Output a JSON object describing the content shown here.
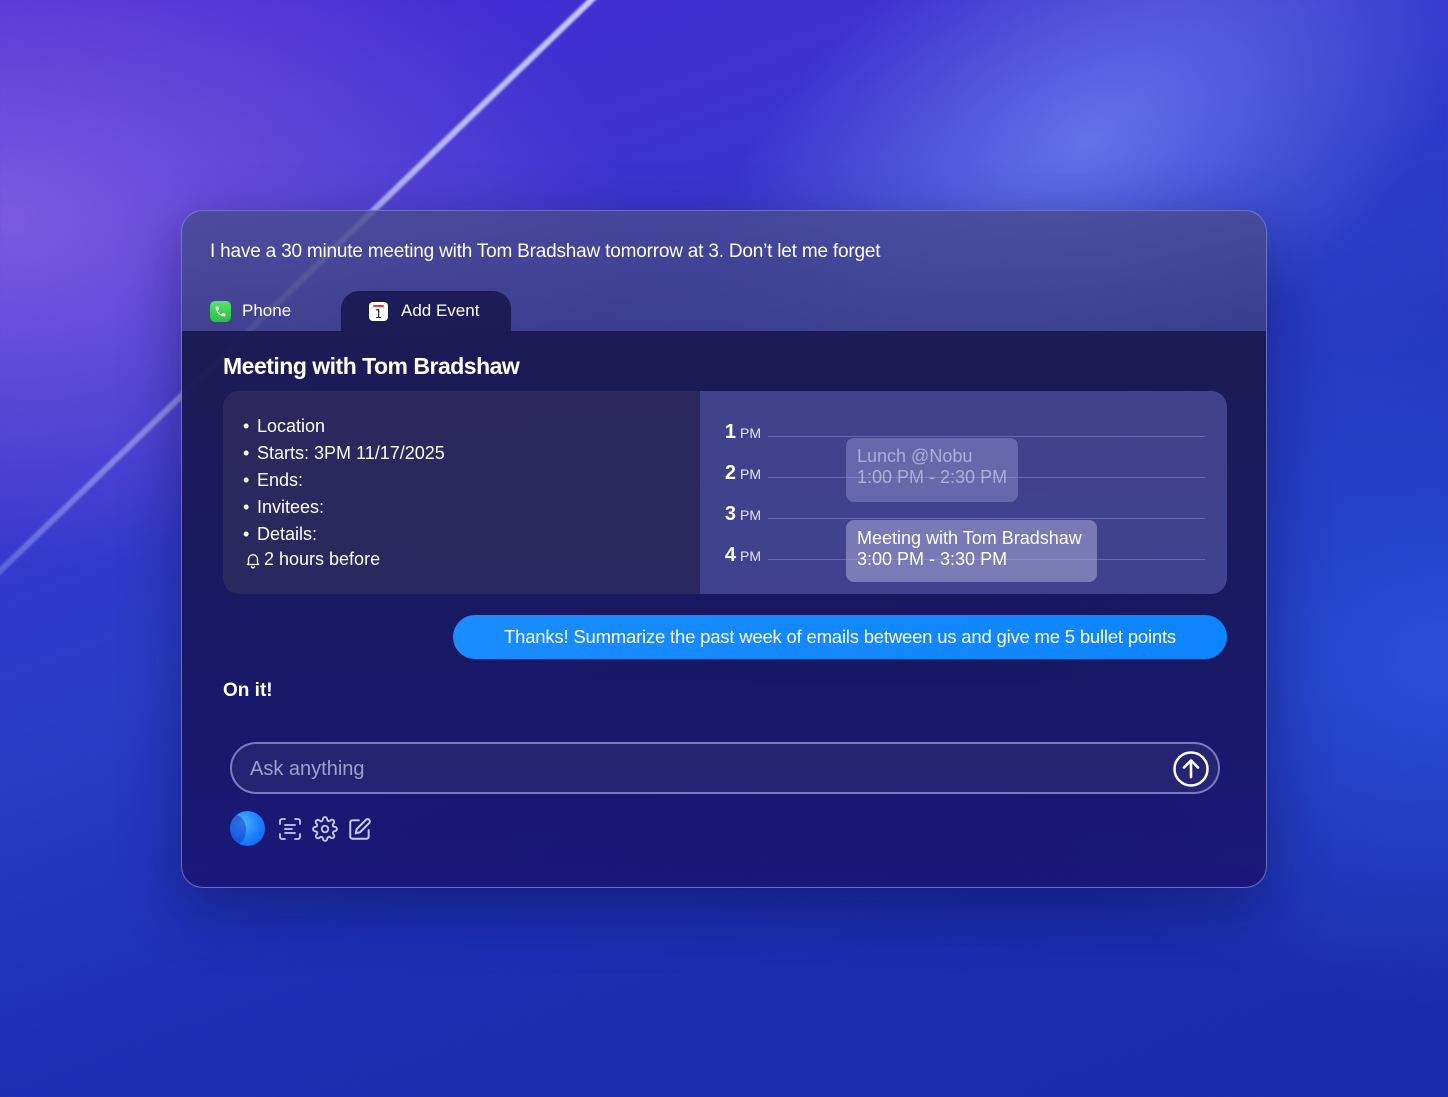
{
  "prompt": {
    "text": "I have a 30 minute meeting with Tom Bradshaw tomorrow at 3. Don’t let me forget"
  },
  "tabs": [
    {
      "label": "Phone",
      "icon": "phone-icon",
      "active": false
    },
    {
      "label": "Add Event",
      "icon": "calendar-icon",
      "active": true
    }
  ],
  "event": {
    "title": "Meeting with Tom Bradshaw",
    "details": [
      "Location",
      "Starts: 3PM 11/17/2025",
      "Ends:",
      "Invitees:",
      "Details:"
    ],
    "reminder": "2 hours before"
  },
  "calendar": {
    "hours": [
      {
        "num": "1",
        "suffix": "PM"
      },
      {
        "num": "2",
        "suffix": "PM"
      },
      {
        "num": "3",
        "suffix": "PM"
      },
      {
        "num": "4",
        "suffix": "PM"
      }
    ],
    "events": [
      {
        "title": "Lunch @Nobu",
        "time": "1:00 PM - 2:30 PM"
      },
      {
        "title": "Meeting with Tom Bradshaw",
        "time": "3:00 PM - 3:30 PM"
      }
    ]
  },
  "chat": {
    "user_message": "Thanks! Summarize the past week of emails between us and give me 5 bullet points",
    "assistant_reply": "On it!"
  },
  "input": {
    "placeholder": "Ask anything",
    "value": ""
  },
  "toolbar": {
    "icons": [
      "assistant-orb-icon",
      "scan-text-icon",
      "gear-icon",
      "compose-icon"
    ]
  },
  "colors": {
    "accent": "#0d84ff",
    "phone_green": "#34c759"
  }
}
